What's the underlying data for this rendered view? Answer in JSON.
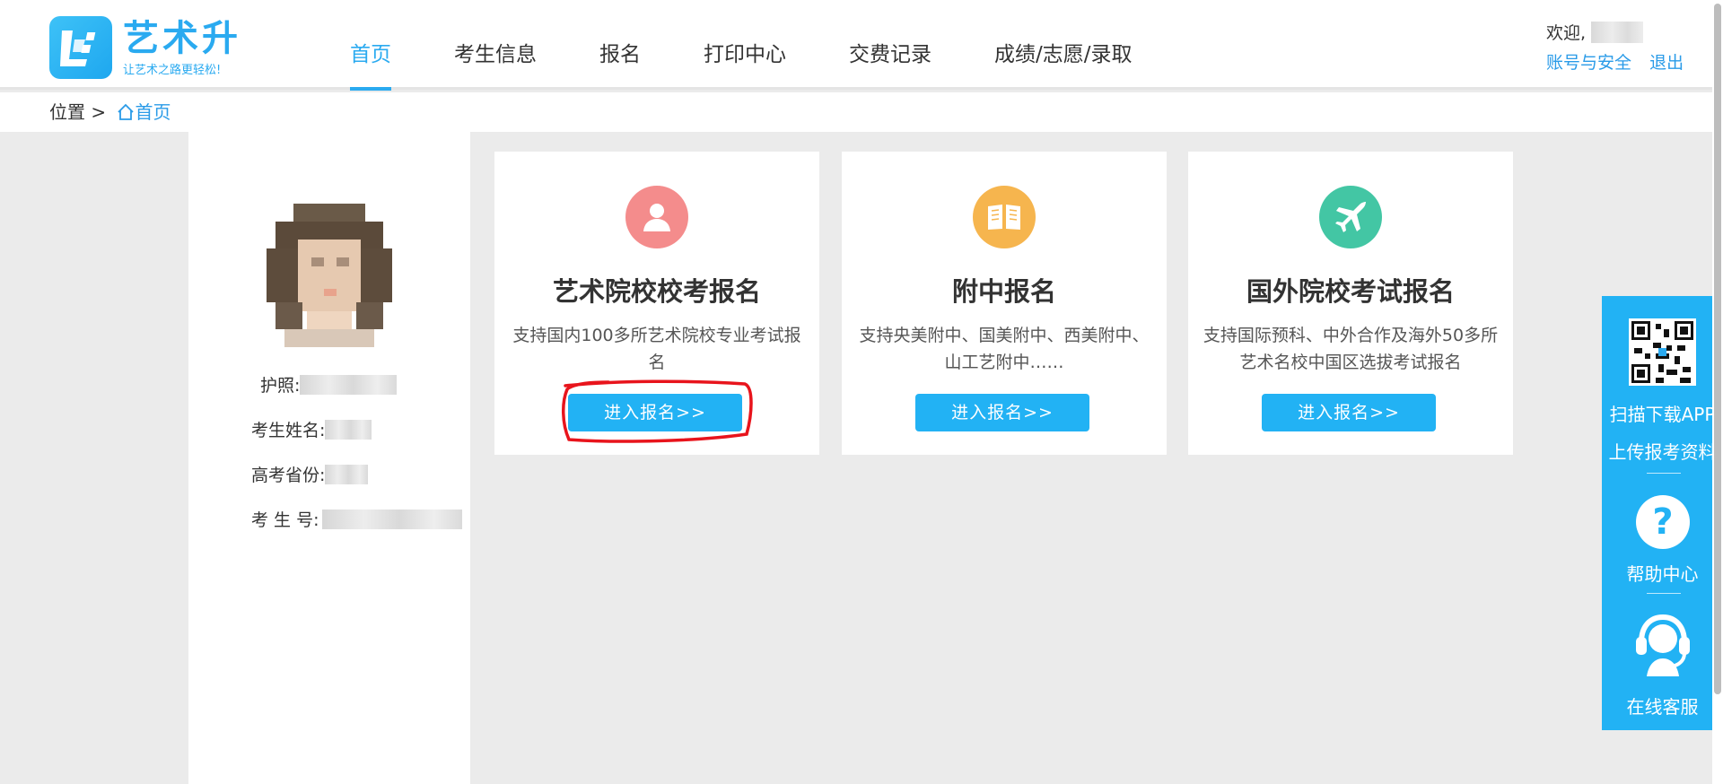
{
  "header": {
    "logo": {
      "title": "艺术升",
      "slogan": "让艺术之路更轻松!"
    },
    "nav": [
      {
        "label": "首页",
        "active": true
      },
      {
        "label": "考生信息",
        "active": false
      },
      {
        "label": "报名",
        "active": false
      },
      {
        "label": "打印中心",
        "active": false
      },
      {
        "label": "交费记录",
        "active": false
      },
      {
        "label": "成绩/志愿/录取",
        "active": false
      }
    ],
    "user": {
      "welcome": "欢迎,",
      "account_link": "账号与安全",
      "logout_link": "退出"
    }
  },
  "breadcrumb": {
    "prefix": "位置 >",
    "home": "首页"
  },
  "profile": {
    "passport_label": "护照:",
    "name_label": "考生姓名:",
    "province_label": "高考省份:",
    "exam_no_label": "考 生 号:"
  },
  "cards": [
    {
      "title": "艺术院校校考报名",
      "desc": "支持国内100多所艺术院校专业考试报名",
      "button": "进入报名>>",
      "icon": "user-icon",
      "color": "#f48c8c"
    },
    {
      "title": "附中报名",
      "desc": "支持央美附中、国美附中、西美附中、山工艺附中……",
      "button": "进入报名>>",
      "icon": "book-icon",
      "color": "#f6b54e"
    },
    {
      "title": "国外院校考试报名",
      "desc": "支持国际预科、中外合作及海外50多所艺术名校中国区选拔考试报名",
      "button": "进入报名>>",
      "icon": "airplane-icon",
      "color": "#43c6a4"
    }
  ],
  "float_panel": {
    "scan_download": "扫描下载APP",
    "upload": "上传报考资料",
    "help": "帮助中心",
    "service": "在线客服"
  },
  "colors": {
    "accent": "#2aaaf0",
    "button": "#22b2f4",
    "page_bg": "#ebebeb",
    "annotation": "#e8141c"
  }
}
